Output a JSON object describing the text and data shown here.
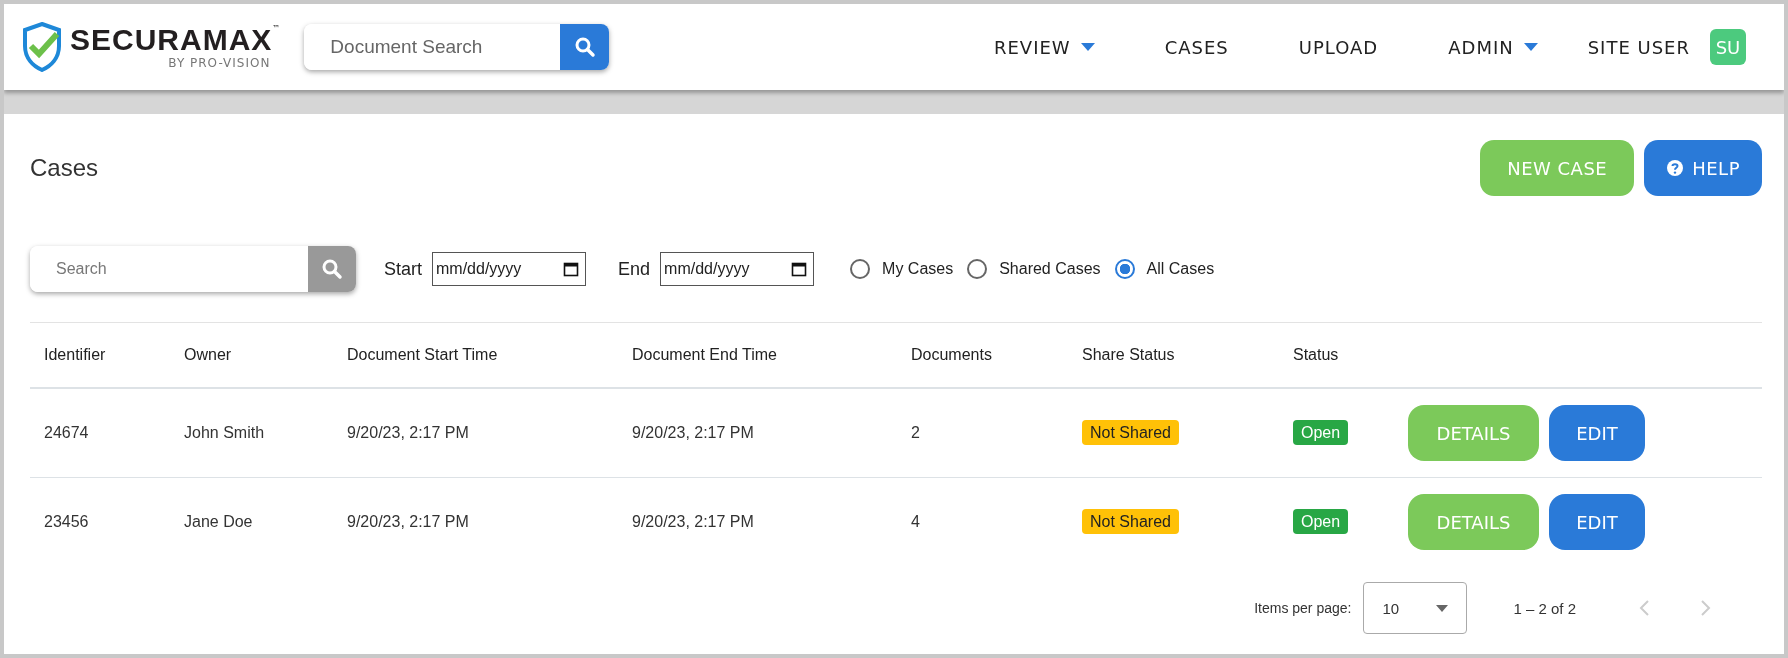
{
  "header": {
    "logo": {
      "name": "SECURAMAX",
      "trademark": "™",
      "tagline": "BY PRO-VISION"
    },
    "search": {
      "placeholder": "Document Search"
    },
    "nav": [
      {
        "label": "REVIEW",
        "dropdown": true
      },
      {
        "label": "CASES",
        "dropdown": false
      },
      {
        "label": "UPLOAD",
        "dropdown": false
      },
      {
        "label": "ADMIN",
        "dropdown": true
      }
    ],
    "user": {
      "name": "SITE USER",
      "initials": "SU"
    }
  },
  "page": {
    "title": "Cases",
    "buttons": [
      {
        "label": "NEW CASE",
        "kind": "primary"
      },
      {
        "label": "HELP",
        "kind": "help"
      }
    ]
  },
  "filters": {
    "search": {
      "placeholder": "Search"
    },
    "start": {
      "label": "Start",
      "placeholder": "mm/dd/yyyy"
    },
    "end": {
      "label": "End",
      "placeholder": "mm/dd/yyyy"
    },
    "scope": [
      {
        "label": "My Cases",
        "selected": false
      },
      {
        "label": "Shared Cases",
        "selected": false
      },
      {
        "label": "All Cases",
        "selected": true
      }
    ]
  },
  "table": {
    "columns": [
      "Identifier",
      "Owner",
      "Document Start Time",
      "Document End Time",
      "Documents",
      "Share Status",
      "Status"
    ],
    "rows": [
      {
        "identifier": "24674",
        "owner": "John Smith",
        "start": "9/20/23, 2:17 PM",
        "end": "9/20/23, 2:17 PM",
        "documents": "2",
        "share_status": "Not Shared",
        "status": "Open",
        "actions": [
          "DETAILS",
          "EDIT"
        ]
      },
      {
        "identifier": "23456",
        "owner": "Jane Doe",
        "start": "9/20/23, 2:17 PM",
        "end": "9/20/23, 2:17 PM",
        "documents": "4",
        "share_status": "Not Shared",
        "status": "Open",
        "actions": [
          "DETAILS",
          "EDIT"
        ]
      }
    ]
  },
  "pagination": {
    "label": "Items per page:",
    "page_size": "10",
    "range": "1 – 2 of 2"
  }
}
